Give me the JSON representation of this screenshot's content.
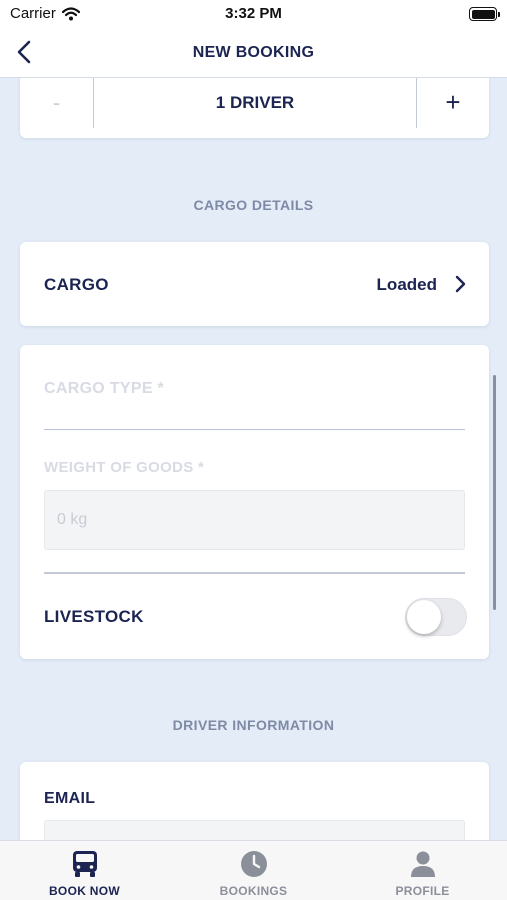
{
  "status_bar": {
    "carrier": "Carrier",
    "time": "3:32 PM"
  },
  "nav": {
    "title": "NEW BOOKING"
  },
  "driver_stepper": {
    "minus_label": "-",
    "value": "1 DRIVER",
    "plus_label": "+"
  },
  "cargo_section": {
    "heading": "CARGO DETAILS",
    "cargo_row": {
      "label": "CARGO",
      "value": "Loaded"
    },
    "cargo_type_label": "CARGO TYPE *",
    "weight_label": "WEIGHT OF GOODS *",
    "weight_placeholder": "0 kg",
    "livestock_label": "LIVESTOCK",
    "livestock_on": false
  },
  "driver_section": {
    "heading": "DRIVER INFORMATION",
    "email_label": "EMAIL"
  },
  "tabbar": {
    "tabs": [
      {
        "label": "BOOK NOW",
        "icon": "truck-icon",
        "active": true
      },
      {
        "label": "BOOKINGS",
        "icon": "clock-icon",
        "active": false
      },
      {
        "label": "PROFILE",
        "icon": "person-icon",
        "active": false
      }
    ]
  },
  "colors": {
    "primary_navy": "#1c2452",
    "background": "#e3ecf7",
    "muted_heading": "#7e8aa6",
    "inactive_tab": "#8b8f99"
  }
}
